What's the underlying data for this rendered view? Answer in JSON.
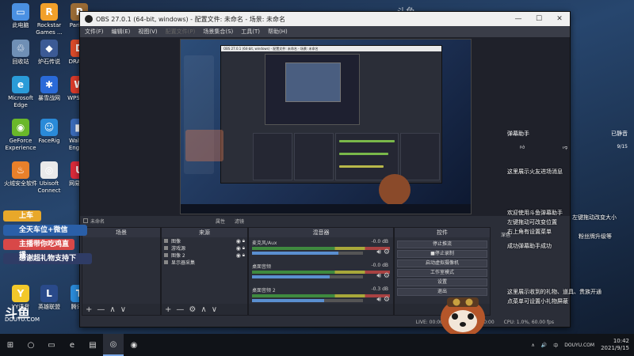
{
  "desktop": {
    "icons": [
      {
        "label": "此电脑",
        "color": "#4a90e2",
        "glyph": "▭"
      },
      {
        "label": "Rockstar Games ...",
        "color": "#f2a02a",
        "glyph": "R"
      },
      {
        "label": "PariZ...",
        "color": "#9a6b35",
        "glyph": "P"
      },
      {
        "label": "回收站",
        "color": "#6f8fb5",
        "glyph": "♲"
      },
      {
        "label": "炉石传说",
        "color": "#3c5a95",
        "glyph": "◆"
      },
      {
        "label": "DRAG...",
        "color": "#d84a2a",
        "glyph": "D"
      },
      {
        "label": "Microsoft Edge",
        "color": "#2a9bd8",
        "glyph": "e"
      },
      {
        "label": "暴雪战网",
        "color": "#2a6ad8",
        "glyph": "✱"
      },
      {
        "label": "WPS O...",
        "color": "#d83a2a",
        "glyph": "W"
      },
      {
        "label": "GeForce Experience",
        "color": "#6ab82a",
        "glyph": "◉"
      },
      {
        "label": "FaceRig",
        "color": "#2a8ad8",
        "glyph": "☺"
      },
      {
        "label": "Wallp... Engin...",
        "color": "#3a6ab8",
        "glyph": "◧"
      },
      {
        "label": "火绒安全软件",
        "color": "#e8802a",
        "glyph": "♨"
      },
      {
        "label": "Ubisoft Connect",
        "color": "#eaeaea",
        "glyph": "◎"
      },
      {
        "label": "网易U...",
        "color": "#d82a3a",
        "glyph": "U"
      },
      {
        "label": "YY语音",
        "color": "#f2c82a",
        "glyph": "Y"
      },
      {
        "label": "英雄联盟",
        "color": "#2a4a8a",
        "glyph": "L"
      },
      {
        "label": "腾讯...",
        "color": "#2a8ad8",
        "glyph": "T"
      }
    ]
  },
  "obs": {
    "title": "OBS 27.0.1 (64-bit, windows) - 配置文件: 未命名 - 场景: 未命名",
    "window_controls": [
      "—",
      "☐",
      "✕"
    ],
    "menu": [
      "文件(F)",
      "编辑(E)",
      "视图(V)",
      "配置文件(P)",
      "场景集合(S)",
      "工具(T)",
      "帮助(H)"
    ],
    "preview_status": {
      "left": "未命名",
      "mid1": "属性",
      "mid2": "滤镜"
    },
    "scenes": {
      "title": "场景",
      "footer": [
        "+",
        "—",
        "∧",
        "∨"
      ]
    },
    "sources": {
      "title": "来源",
      "items": [
        "图像",
        "游戏源",
        "图像 2",
        "显示器采集"
      ],
      "footer": [
        "+",
        "—",
        "⚙",
        "∧",
        "∨"
      ]
    },
    "mixer": {
      "title": "混音器",
      "channels": [
        {
          "name": "麦克风/Aux",
          "db": "-0.0 dB",
          "level": 0.78
        },
        {
          "name": "桌面音频",
          "db": "-0.0 dB",
          "level": 0.7
        },
        {
          "name": "桌面音频 2",
          "db": "-0.3 dB",
          "level": 0.65
        }
      ]
    },
    "controls": {
      "title": "控件",
      "buttons": [
        "停止推流",
        "■停止录制",
        "启动虚拟摄像机",
        "工作室模式",
        "设置",
        "退出"
      ]
    },
    "statusbar": [
      "LIVE: 00:00:00",
      "REC: 00:00:00",
      "CPU: 1.0%, 60.00 fps"
    ]
  },
  "overlay": {
    "header_left": "弹幕助手",
    "header_right": "已静音",
    "stat_right": "9/15",
    "messages": [
      "这里展示火友进场消息",
      "欢迎使用斗鱼弹幕助手",
      "左键拖动可改变位置",
      "右上角有设置菜单",
      "左键拖动改变大小",
      "粉丝牌升级等",
      "成功弹幕助手成功",
      "这里展示收到的礼物、道具、贵族开通",
      "点菜单可设置小礼物屏蔽"
    ],
    "ghost": "深色"
  },
  "promo": [
    "上车",
    "全天车位+微信",
    "主播带你吃鸡直播",
    "感谢超礼物支持下"
  ],
  "watermark": {
    "logo": "斗鱼",
    "site": "DOUYU.COM",
    "top": "斗鱼"
  },
  "taskbar": {
    "items": [
      "⊞",
      "○",
      "▭",
      "e",
      "▤",
      "◎",
      "◉"
    ],
    "tray": [
      "∧",
      "🔊",
      "中",
      "DOUYU.COM"
    ],
    "time": "10:42",
    "date": "2021/9/15"
  }
}
